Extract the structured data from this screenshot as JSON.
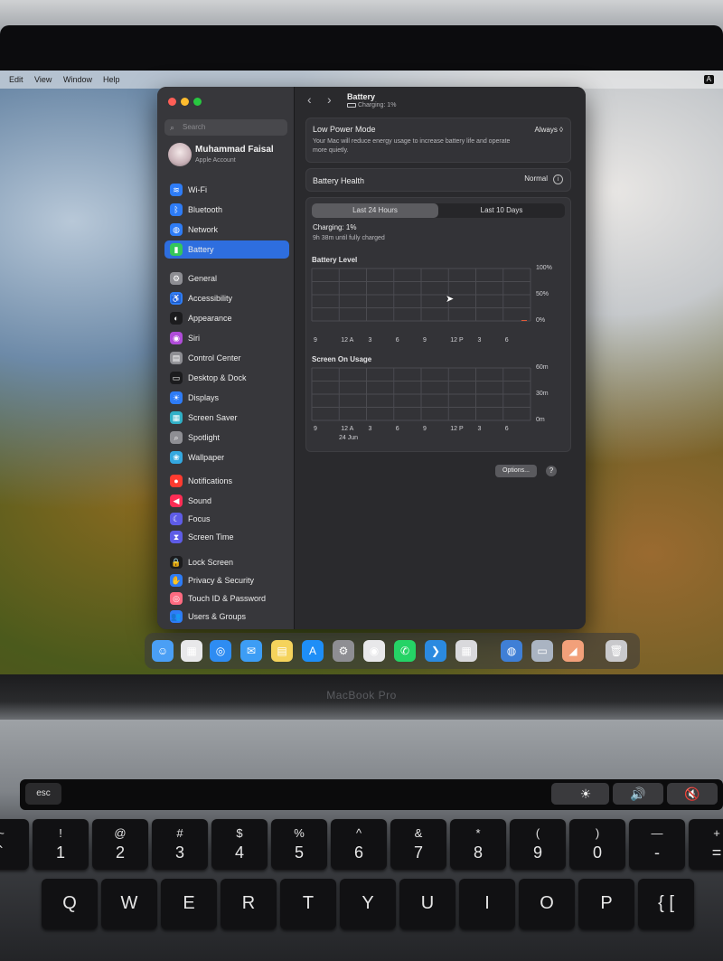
{
  "menubar": {
    "items": [
      "Edit",
      "View",
      "Window",
      "Help"
    ],
    "input_indicator": "A"
  },
  "sidebar": {
    "search_placeholder": "Search",
    "profile": {
      "name": "Muhammad Faisal",
      "subtitle": "Apple Account"
    },
    "items": [
      {
        "label": "Wi-Fi",
        "icon": "wifi-icon",
        "color": "#2e7cf6"
      },
      {
        "label": "Bluetooth",
        "icon": "bluetooth-icon",
        "color": "#2e7cf6"
      },
      {
        "label": "Network",
        "icon": "globe-icon",
        "color": "#2e7cf6"
      },
      {
        "label": "Battery",
        "icon": "battery-icon",
        "color": "#35c759",
        "active": true
      },
      {
        "label": "General",
        "icon": "gear-icon",
        "color": "#8e8e93"
      },
      {
        "label": "Accessibility",
        "icon": "accessibility-icon",
        "color": "#2e7cf6"
      },
      {
        "label": "Appearance",
        "icon": "appearance-icon",
        "color": "#1c1c1e"
      },
      {
        "label": "Siri",
        "icon": "siri-icon",
        "color": "#b04cd9"
      },
      {
        "label": "Control Center",
        "icon": "control-center-icon",
        "color": "#8e8e93"
      },
      {
        "label": "Desktop & Dock",
        "icon": "dock-icon",
        "color": "#1c1c1e"
      },
      {
        "label": "Displays",
        "icon": "sun-icon",
        "color": "#2e7cf6"
      },
      {
        "label": "Screen Saver",
        "icon": "screen-saver-icon",
        "color": "#30b0c7"
      },
      {
        "label": "Spotlight",
        "icon": "magnifier-icon",
        "color": "#8e8e93"
      },
      {
        "label": "Wallpaper",
        "icon": "wallpaper-icon",
        "color": "#34a8e0"
      },
      {
        "label": "Notifications",
        "icon": "bell-icon",
        "color": "#ff3b30"
      },
      {
        "label": "Sound",
        "icon": "speaker-icon",
        "color": "#ff2d55"
      },
      {
        "label": "Focus",
        "icon": "moon-icon",
        "color": "#5e5ce6"
      },
      {
        "label": "Screen Time",
        "icon": "hourglass-icon",
        "color": "#5e5ce6"
      },
      {
        "label": "Lock Screen",
        "icon": "lock-icon",
        "color": "#1c1c1e"
      },
      {
        "label": "Privacy & Security",
        "icon": "hand-icon",
        "color": "#2e7cf6"
      },
      {
        "label": "Touch ID & Password",
        "icon": "fingerprint-icon",
        "color": "#ff6b81"
      },
      {
        "label": "Users & Groups",
        "icon": "users-icon",
        "color": "#2e7cf6"
      }
    ]
  },
  "header": {
    "title": "Battery",
    "subtitle": "Charging: 1%"
  },
  "low_power": {
    "title": "Low Power Mode",
    "description": "Your Mac will reduce energy usage to increase battery life and operate more quietly.",
    "value": "Always ◊"
  },
  "battery_health": {
    "title": "Battery Health",
    "value": "Normal"
  },
  "tabs": {
    "first": "Last 24 Hours",
    "second": "Last 10 Days",
    "selected": "Last 24 Hours"
  },
  "status": {
    "charging": "Charging: 1%",
    "time_remaining": "9h 38m until fully charged"
  },
  "battery_chart": {
    "title": "Battery Level",
    "y_ticks": [
      "100%",
      "50%",
      "0%"
    ],
    "x_ticks": [
      "9",
      "12 A",
      "3",
      "6",
      "9",
      "12 P",
      "3",
      "6"
    ]
  },
  "screen_chart": {
    "title": "Screen On Usage",
    "y_ticks": [
      "60m",
      "30m",
      "0m"
    ],
    "x_ticks": [
      "9",
      "12 A",
      "3",
      "6",
      "9",
      "12 P",
      "3",
      "6"
    ],
    "date_label": "24 Jun"
  },
  "buttons": {
    "options": "Options...",
    "help": "?"
  },
  "chart_data": [
    {
      "type": "bar",
      "title": "Battery Level",
      "categories": [
        "9",
        "12 A",
        "3",
        "6",
        "9",
        "12 P",
        "3",
        "6"
      ],
      "ylim": [
        0,
        100
      ],
      "y_unit": "%",
      "latest_value": 1
    },
    {
      "type": "bar",
      "title": "Screen On Usage",
      "categories": [
        "9",
        "12 A",
        "3",
        "6",
        "9",
        "12 P",
        "3",
        "6"
      ],
      "ylim": [
        0,
        60
      ],
      "y_unit": "m",
      "date_label": "24 Jun"
    }
  ],
  "dock": {
    "apps": [
      {
        "name": "finder-icon",
        "color": "#4a9ff5"
      },
      {
        "name": "launchpad-icon",
        "color": "#e8e8ea"
      },
      {
        "name": "safari-icon",
        "color": "#2e8cf2"
      },
      {
        "name": "mail-icon",
        "color": "#3d9df5"
      },
      {
        "name": "notes-icon",
        "color": "#f5d35c"
      },
      {
        "name": "app-store-icon",
        "color": "#1e8ef7"
      },
      {
        "name": "system-settings-icon",
        "color": "#8e8e93"
      },
      {
        "name": "chrome-icon",
        "color": "#e8e8ea"
      },
      {
        "name": "whatsapp-icon",
        "color": "#25d366"
      },
      {
        "name": "vscode-icon",
        "color": "#2b8ae0"
      },
      {
        "name": "calculator-icon",
        "color": "#d9d9dc"
      },
      {
        "name": "quicktime-icon",
        "color": "#3f7fd6"
      },
      {
        "name": "screenshot-app-icon",
        "color": "#aab4c2"
      },
      {
        "name": "drawing-app-icon",
        "color": "#f2a07a"
      },
      {
        "name": "trash-icon",
        "color": "#c9c9cc"
      }
    ]
  },
  "hardware": {
    "model_label": "MacBook Pro",
    "esc": "esc",
    "number_keys": [
      {
        "top": "~",
        "main": "`"
      },
      {
        "top": "!",
        "main": "1"
      },
      {
        "top": "@",
        "main": "2"
      },
      {
        "top": "#",
        "main": "3"
      },
      {
        "top": "$",
        "main": "4"
      },
      {
        "top": "%",
        "main": "5"
      },
      {
        "top": "^",
        "main": "6"
      },
      {
        "top": "&",
        "main": "7"
      },
      {
        "top": "*",
        "main": "8"
      },
      {
        "top": "(",
        "main": "9"
      },
      {
        "top": ")",
        "main": "0"
      },
      {
        "top": "—",
        "main": "-"
      },
      {
        "top": "+",
        "main": "="
      }
    ],
    "letter_keys": [
      "Q",
      "W",
      "E",
      "R",
      "T",
      "Y",
      "U",
      "I",
      "O",
      "P",
      "{ ["
    ]
  }
}
